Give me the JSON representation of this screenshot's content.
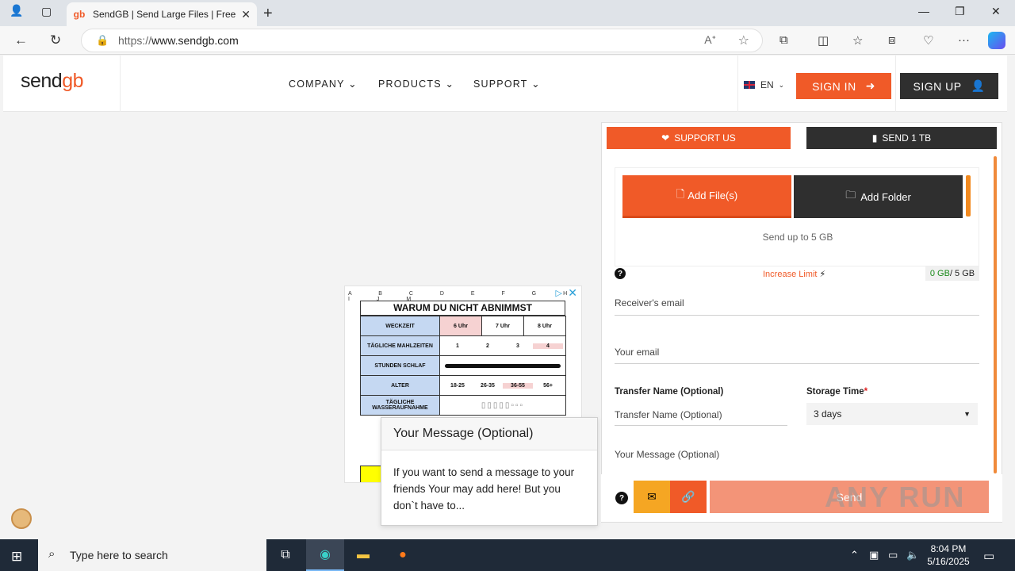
{
  "browser": {
    "tab_title": "SendGB | Send Large Files | Free f",
    "url_prefix": "https://",
    "url_host": "www.sendgb.com",
    "reader_icon": "read-aloud-icon"
  },
  "site": {
    "logo_text": "send",
    "logo_accent": "gb",
    "menu": [
      "COMPANY",
      "PRODUCTS",
      "SUPPORT"
    ],
    "lang": "EN",
    "sign_in": "SIGN IN",
    "sign_up": "SIGN UP"
  },
  "panel": {
    "support_us": "SUPPORT US",
    "send_1tb": "SEND 1 TB",
    "add_files": "Add File(s)",
    "add_folder": "Add Folder",
    "send_up_to": "Send up to 5 GB",
    "increase_limit": "Increase Limit",
    "quota_used": "0 GB",
    "quota_total": " / 5 GB",
    "receivers_email": "Receiver's email",
    "your_email": "Your email",
    "transfer_name_label": "Transfer Name (Optional)",
    "transfer_name_placeholder": "Transfer Name (Optional)",
    "storage_time_label": "Storage Time",
    "storage_time_value": "3 days",
    "your_message": "Your Message  (Optional)",
    "send": "Send"
  },
  "tooltip": {
    "title": "Your Message (Optional)",
    "body": "If you want to send a message to your friends Your may add here! But you don`t have to..."
  },
  "ad": {
    "title": "WARUM DU NICHT ABNIMMST",
    "columns": "A B C D E F G H I J M",
    "rows": [
      {
        "label": "WECKZEIT",
        "cells": [
          "6 Uhr",
          "7 Uhr",
          "8 Uhr"
        ]
      },
      {
        "label": "TÄGLICHE MAHLZEITEN",
        "cells": [
          "1",
          "2",
          "3",
          "4"
        ]
      },
      {
        "label": "STUNDEN SCHLAF",
        "cells": []
      },
      {
        "label": "ALTER",
        "cells": [
          "18-25",
          "26-35",
          "36-55",
          "56+"
        ]
      },
      {
        "label": "TÄGLICHE WASSERAUFNAHME",
        "cells": []
      }
    ]
  },
  "taskbar": {
    "search_placeholder": "Type here to search",
    "time": "8:04 PM",
    "date": "5/16/2025"
  },
  "watermark": "ANY RUN",
  "colors": {
    "accent": "#f05a28",
    "dark": "#2f2f2f",
    "gold": "#f5a623"
  }
}
